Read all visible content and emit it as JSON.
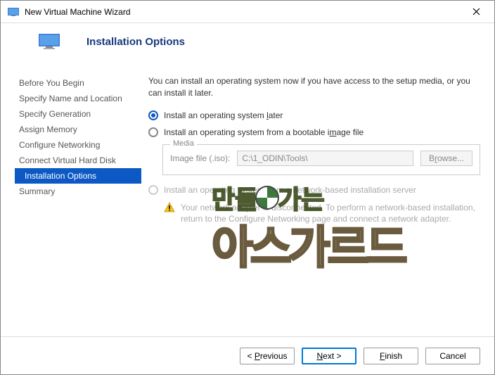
{
  "window": {
    "title": "New Virtual Machine Wizard"
  },
  "header": {
    "title": "Installation Options"
  },
  "sidebar": {
    "items": [
      {
        "label": "Before You Begin"
      },
      {
        "label": "Specify Name and Location"
      },
      {
        "label": "Specify Generation"
      },
      {
        "label": "Assign Memory"
      },
      {
        "label": "Configure Networking"
      },
      {
        "label": "Connect Virtual Hard Disk"
      },
      {
        "label": "Installation Options"
      },
      {
        "label": "Summary"
      }
    ]
  },
  "content": {
    "intro": "You can install an operating system now if you have access to the setup media, or you can install it later.",
    "opt1_pre": "Install an operating system ",
    "opt1_u": "l",
    "opt1_post": "ater",
    "opt2_pre": "Install an operating system from a bootable i",
    "opt2_u": "m",
    "opt2_post": "age file",
    "media": {
      "legend": "Media",
      "label": "Image file (.iso):",
      "value": "C:\\1_ODIN\\Tools\\",
      "browse_pre": "B",
      "browse_u": "r",
      "browse_post": "owse..."
    },
    "opt3": "Install an operating system from a network-based installation server",
    "warn": "Your network adapter is disconnected. To perform a network-based installation, return to the Configure Networking page and connect a network adapter."
  },
  "buttons": {
    "prev_pre": "< ",
    "prev_u": "P",
    "prev_post": "revious",
    "next_u": "N",
    "next_post": "ext >",
    "finish_u": "F",
    "finish_post": "inish",
    "cancel": "Cancel"
  }
}
